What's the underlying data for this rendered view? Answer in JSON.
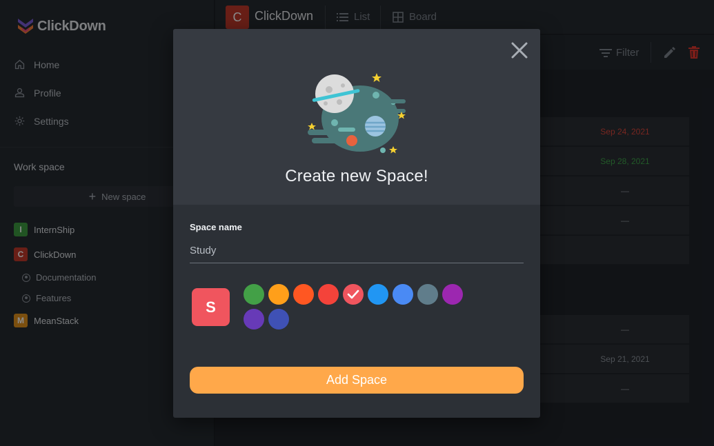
{
  "app": {
    "name": "ClickDown"
  },
  "sidebar": {
    "nav": [
      {
        "label": "Home",
        "icon": "home-icon"
      },
      {
        "label": "Profile",
        "icon": "user-icon"
      },
      {
        "label": "Settings",
        "icon": "gear-icon"
      }
    ],
    "workspace_title": "Work space",
    "new_space_label": "New space",
    "spaces": [
      {
        "letter": "I",
        "label": "InternShip",
        "color": "#3d9a40"
      },
      {
        "letter": "C",
        "label": "ClickDown",
        "color": "#c0392b"
      },
      {
        "letter": "M",
        "label": "MeanStack",
        "color": "#e0901c"
      }
    ],
    "sub_items": [
      "Documentation",
      "Features"
    ]
  },
  "topbar": {
    "badge_letter": "C",
    "title": "ClickDown",
    "tabs": [
      "List",
      "Board"
    ]
  },
  "toolbar": {
    "filter_label": "Filter"
  },
  "rows": [
    {
      "date": "Sep 24, 2021",
      "color": "#d9463b"
    },
    {
      "date": "Sep 28, 2021",
      "color": "#3fa34a"
    },
    {
      "date": "—",
      "color": "#8d939b"
    },
    {
      "date": "—",
      "color": "#8d939b"
    },
    {
      "date": "—",
      "color": "#8d939b"
    },
    {
      "date": "Sep 21, 2021",
      "color": "#8d939b"
    },
    {
      "date": "—",
      "color": "#8d939b"
    }
  ],
  "modal": {
    "title": "Create new Space!",
    "field_label": "Space name",
    "field_value": "Study",
    "preview_letter": "S",
    "selected_color": "#f0555e",
    "colors": [
      "#43a047",
      "#ff9f1a",
      "#ff5722",
      "#f4433a",
      "#f0555e",
      "#2196f3",
      "#4a8af4",
      "#607d8b",
      "#9c27b0",
      "#673ab7",
      "#3f51b5"
    ],
    "submit_label": "Add Space"
  }
}
